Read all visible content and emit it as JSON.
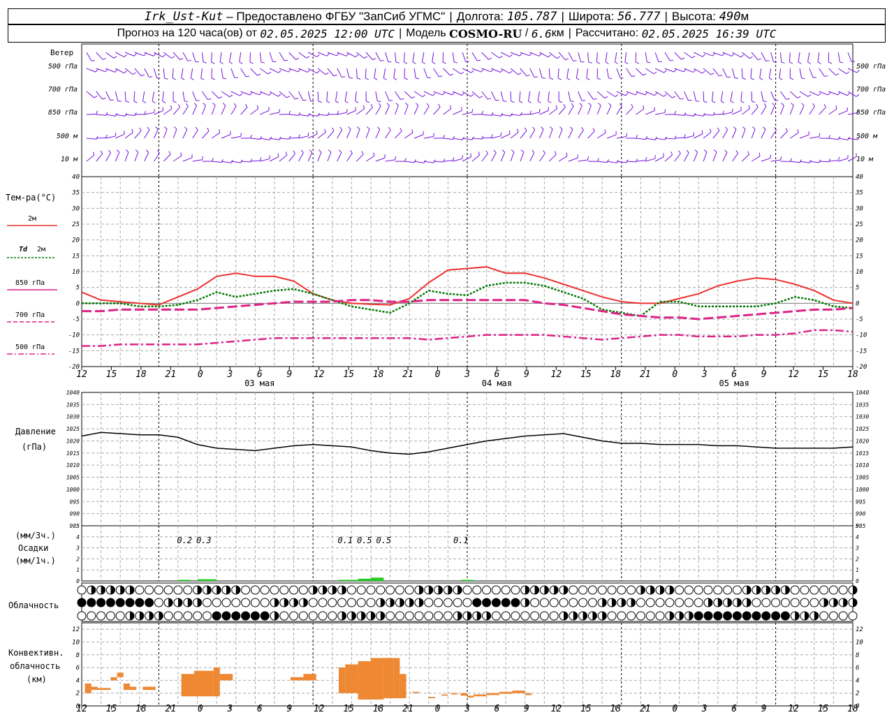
{
  "header": {
    "station": "Irk_Ust-Kut",
    "dash": " – Предоставлено ФГБУ \"ЗапСиб УГМС\"",
    "lon_label": "Долгота:",
    "lon": "105.787",
    "lat_label": "Широта:",
    "lat": "56.777",
    "alt_label": "Высота:",
    "alt": "490",
    "alt_unit": "м",
    "forecast_label": "Прогноз на 120 часа(ов) от",
    "forecast_time": "02.05.2025 12:00 UTC",
    "model_label": "Модель",
    "model": "COSMO-RU",
    "model_res": "6.6",
    "model_res_unit": "км",
    "calc_label": "Рассчитано:",
    "calc_time": "02.05.2025 16:39 UTC"
  },
  "labels": {
    "wind": "Ветер",
    "levels": [
      "500 гПа",
      "700 гПа",
      "850 гПа",
      "500 м",
      "10 м"
    ],
    "temp": "Тем-ра(°C)",
    "t2m": "2м",
    "td": "Td",
    "td_2m": "2м",
    "l850": "850 гПа",
    "l700": "700 гПа",
    "l500": "500 гПа",
    "pressure": "Давление",
    "pressure_unit": "(гПа)",
    "precip_3h": "(мм/3ч.)",
    "precip": "Осадки",
    "precip_1h": "(мм/1ч.)",
    "cloud": "Облачность",
    "conv1": "Конвективн.",
    "conv2": "облачность",
    "conv3": "(км)"
  },
  "colors": {
    "t2m": "#ee3030",
    "td": "#007700",
    "t850": "#dd2288",
    "wind": "#7711dd",
    "precip": "#22cc22",
    "conv": "#ee8833",
    "pressure": "#000000"
  },
  "chart_data": {
    "type": "line",
    "x_hours": [
      0,
      3,
      6,
      9,
      12,
      15,
      18,
      21,
      24,
      27,
      30,
      33,
      36,
      39,
      42,
      45,
      48,
      51,
      54,
      57,
      60,
      63,
      66,
      69,
      72,
      75,
      78,
      81,
      84,
      87,
      90,
      93,
      96,
      99,
      102,
      105,
      108,
      111,
      114,
      117,
      120
    ],
    "x_tick_labels": [
      "12",
      "15",
      "18",
      "21",
      "0",
      "3",
      "6",
      "9",
      "12",
      "15",
      "18",
      "21",
      "0",
      "3",
      "6",
      "9",
      "12",
      "15",
      "18",
      "21",
      "0",
      "3",
      "6",
      "9",
      "12",
      "15",
      "18"
    ],
    "date_labels": [
      "03 мая",
      "04 мая",
      "05 мая"
    ],
    "temp": {
      "ylim": [
        -20,
        40
      ],
      "ticks": [
        -20,
        -15,
        -10,
        -5,
        0,
        5,
        10,
        15,
        20,
        25,
        30,
        35,
        40
      ],
      "series": [
        {
          "name": "2м",
          "values": [
            3.5,
            1,
            0.5,
            0,
            -0.5,
            2,
            4.5,
            8.5,
            9.5,
            8.5,
            8.5,
            7,
            3,
            1,
            0,
            -0.3,
            -0.5,
            1.5,
            6.5,
            10.5,
            11,
            11.5,
            9.5,
            9.5,
            8,
            6,
            4,
            2,
            0.5,
            0,
            0,
            1.5,
            3,
            5.5,
            7,
            8,
            7.5,
            6,
            4,
            1,
            0
          ]
        },
        {
          "name": "Td 2м",
          "values": [
            0,
            0,
            0,
            -1,
            -1,
            -0.5,
            1,
            3.5,
            2,
            3,
            4,
            4.5,
            3,
            1,
            -1,
            -2,
            -3,
            0,
            4,
            3,
            2.5,
            5.5,
            6.5,
            6.5,
            5.5,
            3.5,
            1.5,
            -2,
            -3,
            -4,
            0.5,
            0.5,
            -1,
            -1,
            -1,
            -1,
            0,
            2,
            1,
            -1,
            -1.5
          ]
        },
        {
          "name": "850 гПа",
          "values": [
            -2.5,
            -2.5,
            -2,
            -2,
            -2,
            -2,
            -2,
            -1.5,
            -1,
            -0.5,
            0,
            0.5,
            0.5,
            0.5,
            1,
            1,
            0.5,
            0.5,
            1,
            1,
            1,
            1,
            1,
            1,
            0,
            -0.5,
            -1.5,
            -2.5,
            -3.5,
            -4,
            -4.5,
            -4.5,
            -5,
            -4.5,
            -4,
            -3.5,
            -3,
            -2.5,
            -2,
            -2,
            -1.5
          ]
        },
        {
          "name": "700 гПа",
          "values": []
        },
        {
          "name": "500 гПа",
          "values": [
            -13.5,
            -13.5,
            -13,
            -13,
            -13,
            -13,
            -13,
            -12.5,
            -12,
            -11.5,
            -11,
            -11,
            -11,
            -11,
            -11,
            -11,
            -11,
            -11,
            -11.5,
            -11,
            -10.5,
            -10,
            -10,
            -10,
            -10,
            -10.5,
            -11,
            -11.5,
            -11,
            -10.5,
            -10,
            -10,
            -10.5,
            -10.5,
            -10.5,
            -10,
            -10,
            -9.5,
            -8.5,
            -8.5,
            -9
          ]
        }
      ]
    },
    "pressure": {
      "ylim": [
        985,
        1040
      ],
      "ticks": [
        985,
        990,
        995,
        1000,
        1005,
        1010,
        1015,
        1020,
        1025,
        1030,
        1035,
        1040
      ],
      "values": [
        1022,
        1023.5,
        1023,
        1022.5,
        1022.5,
        1021.5,
        1018.5,
        1017,
        1016.5,
        1016,
        1017,
        1018,
        1018.5,
        1018,
        1017.5,
        1016,
        1015,
        1014.5,
        1015.5,
        1017,
        1018.5,
        1020,
        1021,
        1022,
        1022.5,
        1023,
        1021.5,
        1020,
        1019,
        1019,
        1018.5,
        1018.5,
        1018.5,
        1018,
        1018,
        1017.5,
        1017,
        1017,
        1017,
        1017,
        1017.5
      ]
    },
    "precip": {
      "ylim": [
        0,
        5
      ],
      "ticks": [
        0,
        1,
        2,
        3,
        4,
        5
      ],
      "labels": [
        "0.2",
        "0.3",
        "0.1",
        "0.5",
        "0.5",
        "0.1"
      ],
      "label_hours": [
        16,
        19,
        41,
        44,
        47,
        59
      ],
      "bars": [
        [
          15,
          17,
          0.1
        ],
        [
          18,
          21,
          0.15
        ],
        [
          40,
          43,
          0.1
        ],
        [
          43,
          45,
          0.2
        ],
        [
          45,
          47,
          0.3
        ],
        [
          59,
          61,
          0.1
        ]
      ]
    },
    "convective": {
      "ylim": [
        0,
        13
      ],
      "ticks": [
        0,
        2,
        4,
        6,
        8,
        10,
        12
      ],
      "bars": [
        [
          0.5,
          1.5,
          2,
          3.5
        ],
        [
          1.5,
          2.5,
          2.5,
          3
        ],
        [
          2.5,
          4.5,
          2.5,
          2.8
        ],
        [
          4.5,
          5.5,
          4,
          4.5
        ],
        [
          5.5,
          6.5,
          4.5,
          5.2
        ],
        [
          6.5,
          7.5,
          2.5,
          3.5
        ],
        [
          7.5,
          8.5,
          2.5,
          3
        ],
        [
          9.5,
          11.5,
          2.5,
          3
        ],
        [
          15.5,
          17.5,
          1.5,
          5
        ],
        [
          17.5,
          20.5,
          1.5,
          5.5
        ],
        [
          20.5,
          21.5,
          1.5,
          6
        ],
        [
          21.5,
          23.5,
          4,
          5
        ],
        [
          32.5,
          34.5,
          4,
          4.5
        ],
        [
          34.5,
          36.5,
          4,
          5
        ],
        [
          40,
          41,
          2,
          6
        ],
        [
          41,
          43,
          2,
          6.5
        ],
        [
          43,
          45,
          1,
          7
        ],
        [
          45,
          47,
          1,
          7.5
        ],
        [
          47,
          48.5,
          1.2,
          7.5
        ],
        [
          48.5,
          49.5,
          1.2,
          7.5
        ],
        [
          49.5,
          50.5,
          1.2,
          5
        ],
        [
          51.5,
          52.5,
          2,
          2.2
        ],
        [
          54,
          55,
          1.2,
          1.4
        ],
        [
          56,
          57,
          1.6,
          1.8
        ],
        [
          57.5,
          58.5,
          1.8,
          2
        ],
        [
          59,
          60,
          1.6,
          2
        ],
        [
          60,
          61,
          1.3,
          1.6
        ],
        [
          61,
          63,
          1.5,
          1.8
        ],
        [
          63,
          65,
          1.7,
          2
        ],
        [
          65,
          67,
          1.9,
          2.2
        ],
        [
          67,
          69,
          2,
          2.4
        ],
        [
          69,
          70,
          1.7,
          2
        ]
      ]
    }
  }
}
